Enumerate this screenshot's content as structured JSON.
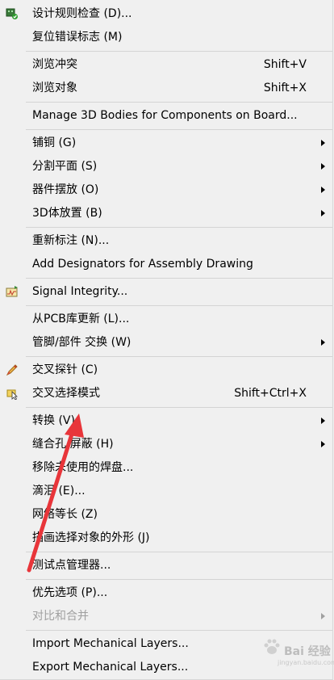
{
  "menu": {
    "items": [
      {
        "label": "设计规则检查 (D)...",
        "shortcut": "",
        "submenu": false,
        "icon": "design-rule-check-icon"
      },
      {
        "label": "复位错误标志 (M)",
        "shortcut": "",
        "submenu": false,
        "icon": ""
      },
      {
        "label": "浏览冲突",
        "shortcut": "Shift+V",
        "submenu": false,
        "icon": ""
      },
      {
        "label": "浏览对象",
        "shortcut": "Shift+X",
        "submenu": false,
        "icon": ""
      },
      {
        "label": "Manage 3D Bodies for Components on Board...",
        "shortcut": "",
        "submenu": false,
        "icon": ""
      },
      {
        "label": "铺铜 (G)",
        "shortcut": "",
        "submenu": true,
        "icon": ""
      },
      {
        "label": "分割平面 (S)",
        "shortcut": "",
        "submenu": true,
        "icon": ""
      },
      {
        "label": "器件摆放 (O)",
        "shortcut": "",
        "submenu": true,
        "icon": ""
      },
      {
        "label": "3D体放置 (B)",
        "shortcut": "",
        "submenu": true,
        "icon": ""
      },
      {
        "label": "重新标注 (N)...",
        "shortcut": "",
        "submenu": false,
        "icon": ""
      },
      {
        "label": "Add Designators for Assembly Drawing",
        "shortcut": "",
        "submenu": false,
        "icon": ""
      },
      {
        "label": "Signal Integrity...",
        "shortcut": "",
        "submenu": false,
        "icon": "signal-integrity-icon"
      },
      {
        "label": "从PCB库更新 (L)...",
        "shortcut": "",
        "submenu": false,
        "icon": ""
      },
      {
        "label": "管脚/部件 交换 (W)",
        "shortcut": "",
        "submenu": true,
        "icon": ""
      },
      {
        "label": "交叉探针 (C)",
        "shortcut": "",
        "submenu": false,
        "icon": "cross-probe-icon"
      },
      {
        "label": "交叉选择模式",
        "shortcut": "Shift+Ctrl+X",
        "submenu": false,
        "icon": "cross-select-icon"
      },
      {
        "label": "转换 (V)",
        "shortcut": "",
        "submenu": true,
        "icon": ""
      },
      {
        "label": "缝合孔/屏蔽 (H)",
        "shortcut": "",
        "submenu": true,
        "icon": ""
      },
      {
        "label": "移除未使用的焊盘...",
        "shortcut": "",
        "submenu": false,
        "icon": ""
      },
      {
        "label": "滴泪 (E)...",
        "shortcut": "",
        "submenu": false,
        "icon": ""
      },
      {
        "label": "网络等长 (Z)",
        "shortcut": "",
        "submenu": false,
        "icon": ""
      },
      {
        "label": "描画选择对象的外形 (J)",
        "shortcut": "",
        "submenu": false,
        "icon": ""
      },
      {
        "label": "测试点管理器...",
        "shortcut": "",
        "submenu": false,
        "icon": ""
      },
      {
        "label": "优先选项 (P)...",
        "shortcut": "",
        "submenu": false,
        "icon": ""
      },
      {
        "label": "对比和合并",
        "shortcut": "",
        "submenu": true,
        "icon": "",
        "disabled": true
      },
      {
        "label": "Import Mechanical Layers...",
        "shortcut": "",
        "submenu": false,
        "icon": ""
      },
      {
        "label": "Export Mechanical Layers...",
        "shortcut": "",
        "submenu": false,
        "icon": ""
      }
    ]
  },
  "annotation": {
    "color": "#e8353a"
  },
  "watermark": {
    "text": "Bai  经验",
    "url": "jingyan.baidu.com"
  }
}
